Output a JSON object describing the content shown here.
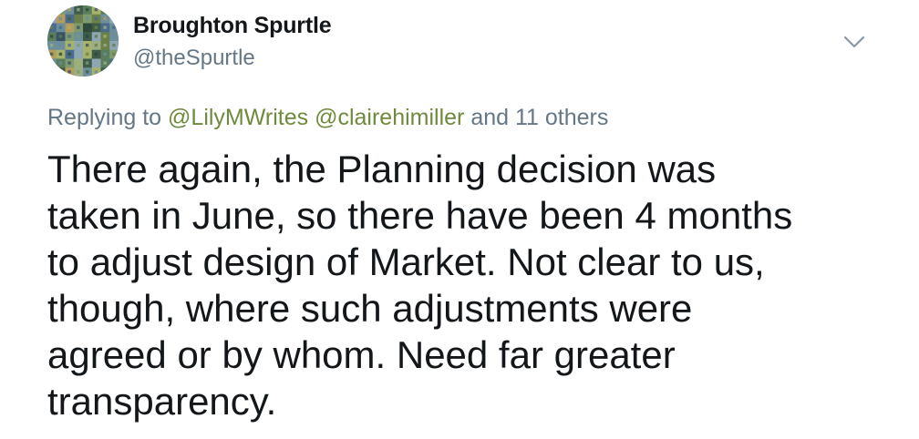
{
  "author": {
    "name": "Broughton Spurtle",
    "handle": "@theSpurtle",
    "avatar_icon": "mosaic-avatar"
  },
  "header": {
    "menu_icon": "chevron-down-icon"
  },
  "reply": {
    "prefix": "Replying to",
    "mentions": [
      "@LilyMWrites",
      "@clairehimiller"
    ],
    "suffix": "and 11 others"
  },
  "tweet": {
    "lines": [
      "There again, the Planning decision was",
      "taken in June, so there have been 4 months",
      "to adjust design of Market. Not clear to us,",
      "though, where such adjustments were",
      "agreed or by whom. Need far greater",
      "transparency."
    ]
  },
  "colors": {
    "text": "#14171a",
    "secondary": "#657786",
    "mention": "#6e8b3d"
  }
}
